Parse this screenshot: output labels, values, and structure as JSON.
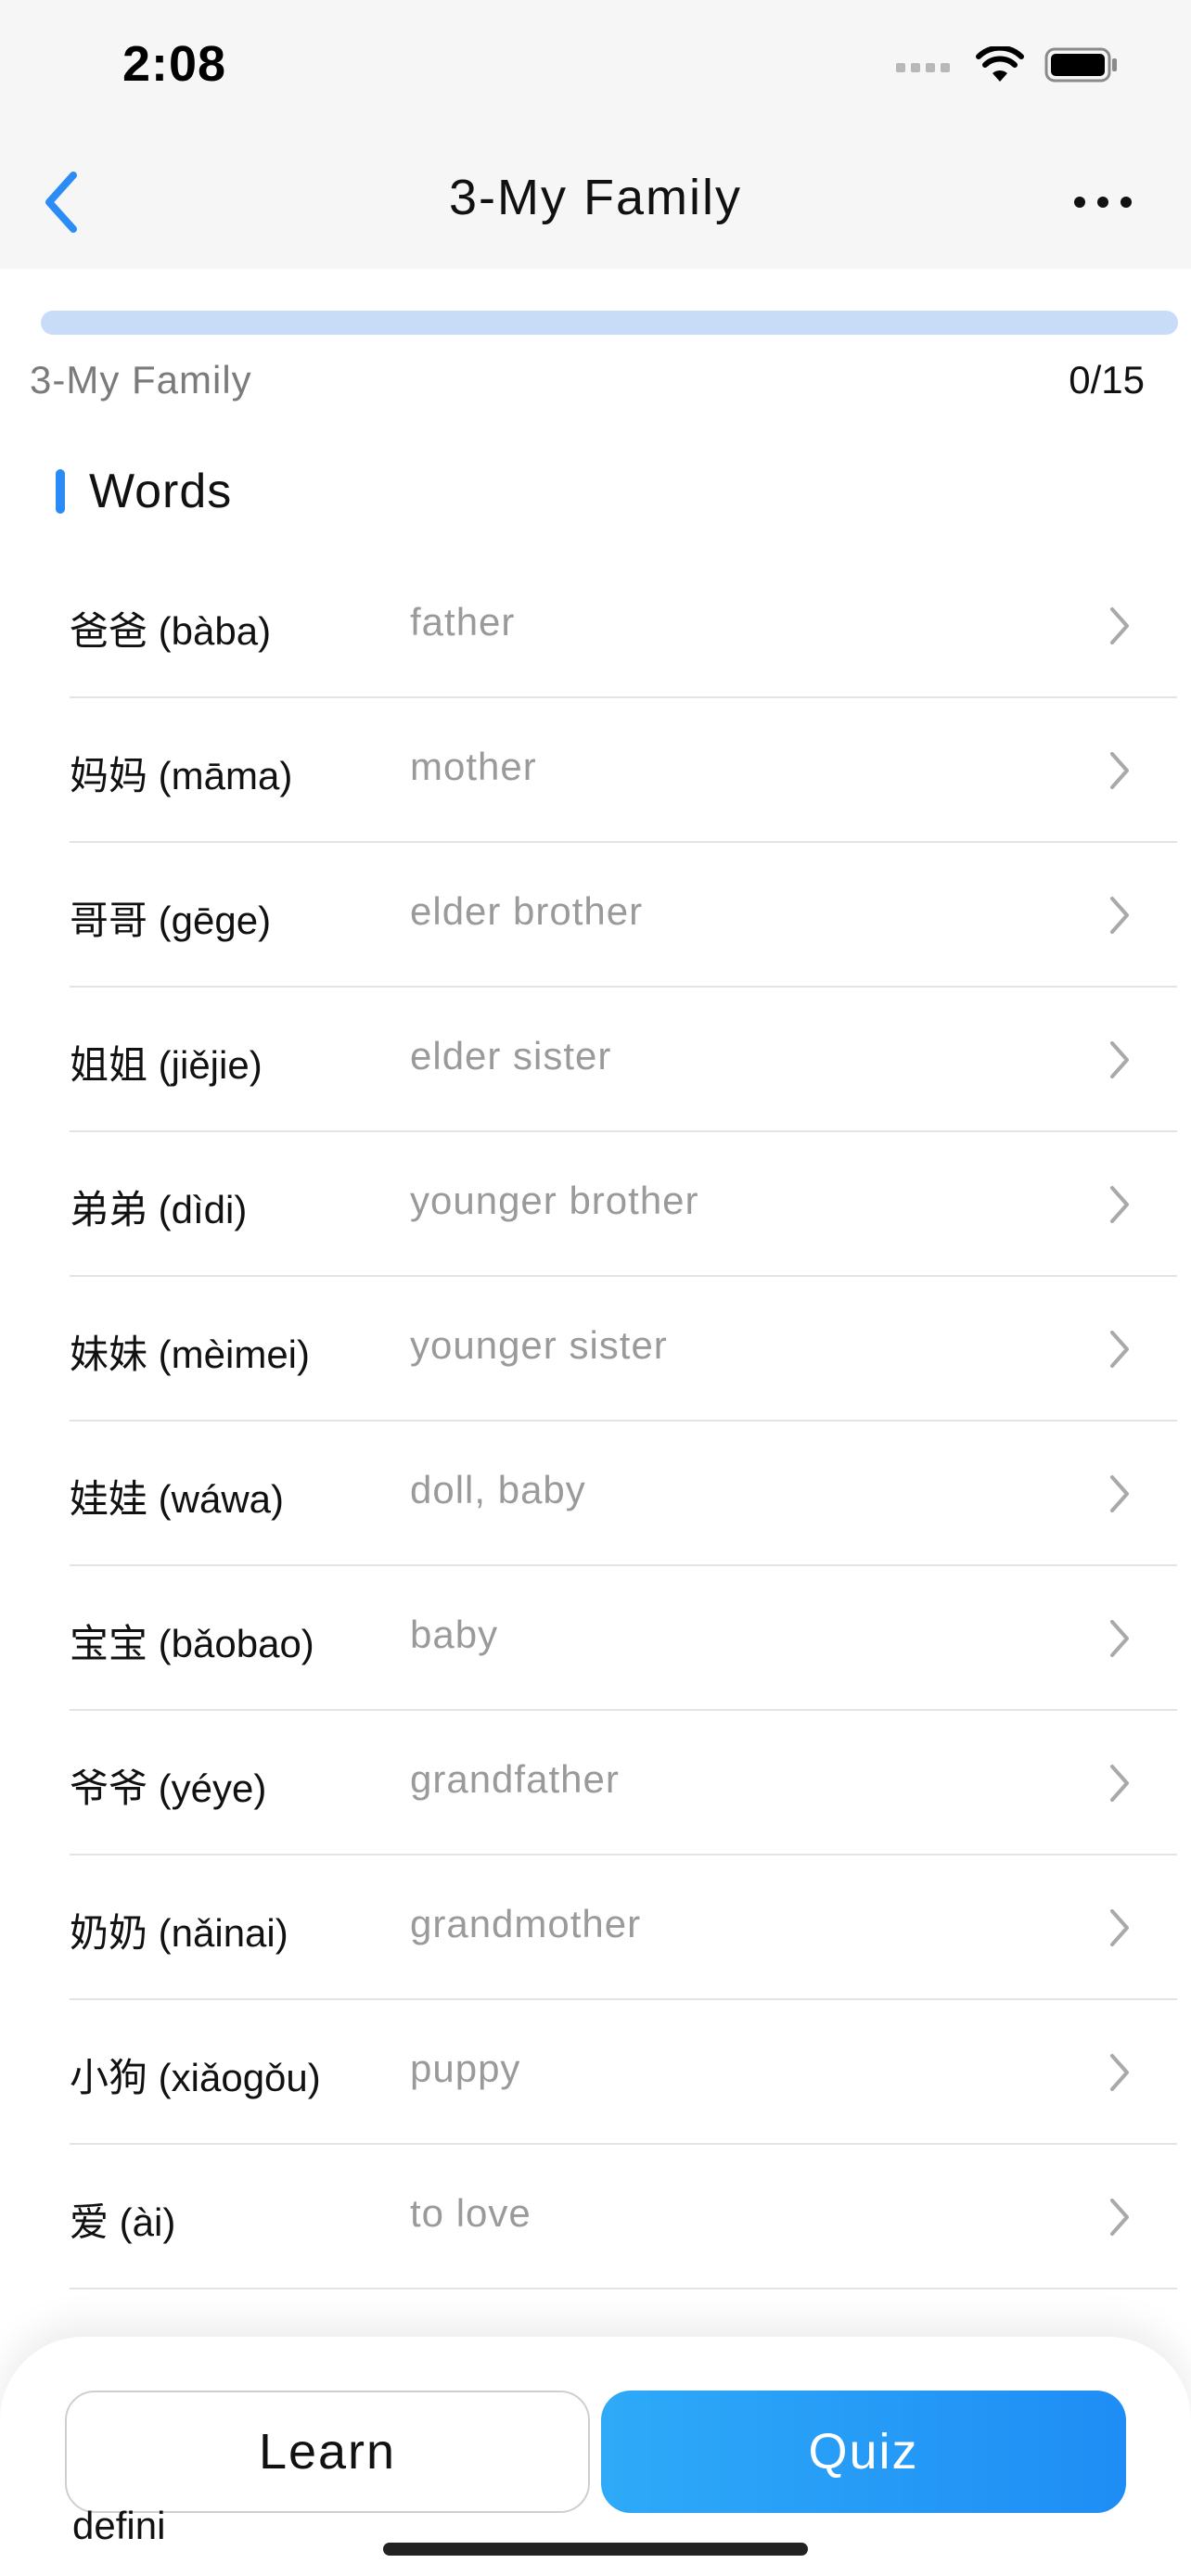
{
  "status_bar": {
    "time": "2:08"
  },
  "nav": {
    "title": "3-My Family"
  },
  "progress": {
    "label": "3-My Family",
    "count": "0/15",
    "fraction": 0.0
  },
  "section": {
    "title": "Words"
  },
  "words": [
    {
      "term": "爸爸 (bàba)",
      "meaning": "father"
    },
    {
      "term": "妈妈 (māma)",
      "meaning": "mother"
    },
    {
      "term": "哥哥 (gēge)",
      "meaning": "elder brother"
    },
    {
      "term": "姐姐 (jiějie)",
      "meaning": "elder sister"
    },
    {
      "term": "弟弟 (dìdi)",
      "meaning": "younger brother"
    },
    {
      "term": "妹妹 (mèimei)",
      "meaning": "younger sister"
    },
    {
      "term": "娃娃 (wáwa)",
      "meaning": "doll, baby"
    },
    {
      "term": "宝宝 (bǎobao)",
      "meaning": "baby"
    },
    {
      "term": "爷爷 (yéye)",
      "meaning": "grandfather"
    },
    {
      "term": "奶奶 (nǎinai)",
      "meaning": "grandmother"
    },
    {
      "term": "小狗 (xiǎogǒu)",
      "meaning": "puppy"
    },
    {
      "term": "爱 (ài)",
      "meaning": "to love"
    }
  ],
  "peek_text": "defini",
  "buttons": {
    "learn": "Learn",
    "quiz": "Quiz"
  },
  "colors": {
    "accent": "#2b8cf5",
    "progress_track": "#c9dcf7",
    "quiz_button": "#1e8df5"
  },
  "icons": {
    "back": "chevron-left-icon",
    "more": "more-horizontal-icon",
    "row": "chevron-right-icon"
  }
}
